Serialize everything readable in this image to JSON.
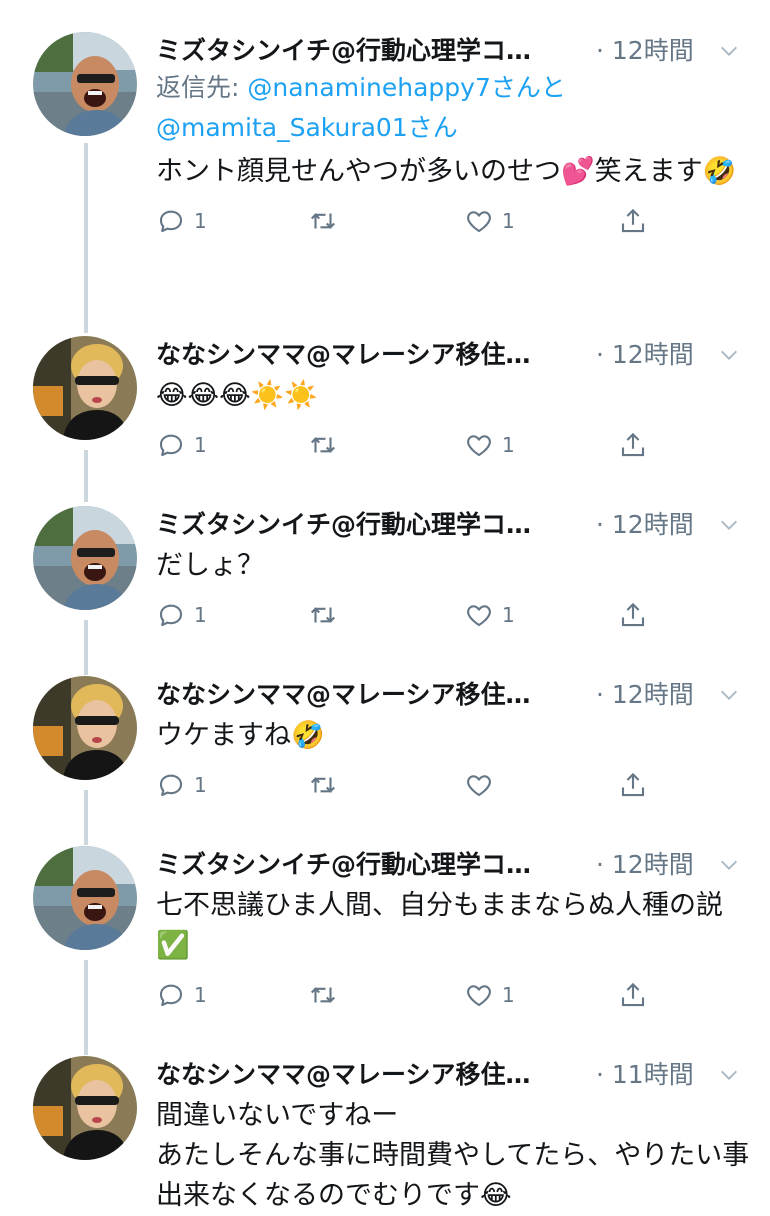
{
  "tweets": [
    {
      "author": "ミズタシンイチ@行動心理学コ…",
      "time": "· 12時間",
      "reply_label": "返信先:",
      "reply_mention1": "@nanaminehappy7さんと",
      "reply_mention2": "@mamita_Sakura01さん",
      "text": "ホント顔見せんやつが多いのせつ💕笑えます🤣",
      "reply_count": "1",
      "retweet_count": "",
      "like_count": "1"
    },
    {
      "author": "ななシンママ@マレーシア移住…",
      "time": "· 12時間",
      "text": "😂😂😂☀️☀️",
      "reply_count": "1",
      "retweet_count": "",
      "like_count": "1"
    },
    {
      "author": "ミズタシンイチ@行動心理学コ…",
      "time": "· 12時間",
      "text": "だしょ？",
      "reply_count": "1",
      "retweet_count": "",
      "like_count": "1"
    },
    {
      "author": "ななシンママ@マレーシア移住…",
      "time": "· 12時間",
      "text": "ウケますね🤣",
      "reply_count": "1",
      "retweet_count": "",
      "like_count": ""
    },
    {
      "author": "ミズタシンイチ@行動心理学コ…",
      "time": "· 12時間",
      "text": "七不思議ひま人間、自分もままならぬ人種の説✅",
      "reply_count": "1",
      "retweet_count": "",
      "like_count": "1"
    },
    {
      "author": "ななシンママ@マレーシア移住…",
      "time": "· 11時間",
      "text": "間違いないですねー\nあたしそんな事に時間費やしてたら、やりたい事出来なくなるのでむりです😂"
    }
  ],
  "colors": {
    "text": "#14171a",
    "secondary": "#657786",
    "link": "#1da1f2",
    "thread_line": "#ccd6dd"
  },
  "icons": [
    "reply-icon",
    "retweet-icon",
    "like-icon",
    "share-icon",
    "chevron-down-icon"
  ]
}
